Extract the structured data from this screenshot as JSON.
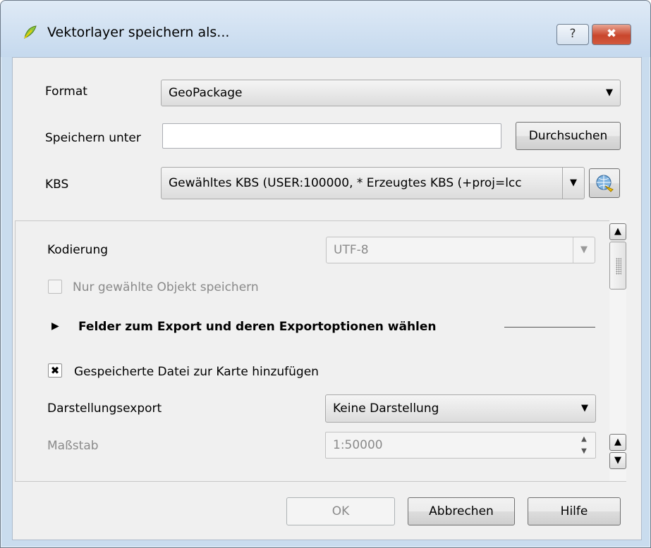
{
  "window": {
    "title": "Vektorlayer speichern als...",
    "help_label": "?",
    "close_label": "✖"
  },
  "form": {
    "format_label": "Format",
    "format_value": "GeoPackage",
    "save_as_label": "Speichern unter",
    "save_as_value": "",
    "browse_button": "Durchsuchen",
    "crs_label": "KBS",
    "crs_value": "Gewähltes KBS (USER:100000,  * Erzeugtes KBS (+proj=lcc"
  },
  "options": {
    "encoding_label": "Kodierung",
    "encoding_value": "UTF-8",
    "selected_only_label": "Nur gewählte Objekt speichern",
    "selected_only_checked": false,
    "fields_section_label": "Felder zum Export und deren Exportoptionen wählen",
    "add_to_map_label": "Gespeicherte Datei zur Karte hinzufügen",
    "add_to_map_checked": true,
    "add_to_map_mark": "✖",
    "symbology_label": "Darstellungsexport",
    "symbology_value": "Keine Darstellung",
    "scale_label": "Maßstab",
    "scale_value": "1:50000"
  },
  "buttons": {
    "ok": "OK",
    "cancel": "Abbrechen",
    "help": "Hilfe"
  },
  "icons": {
    "combo_arrow": "▼",
    "expand_arrow": "▶",
    "scroll_up": "▲",
    "scroll_down": "▼",
    "spin_up": "▲",
    "spin_down": "▼"
  }
}
